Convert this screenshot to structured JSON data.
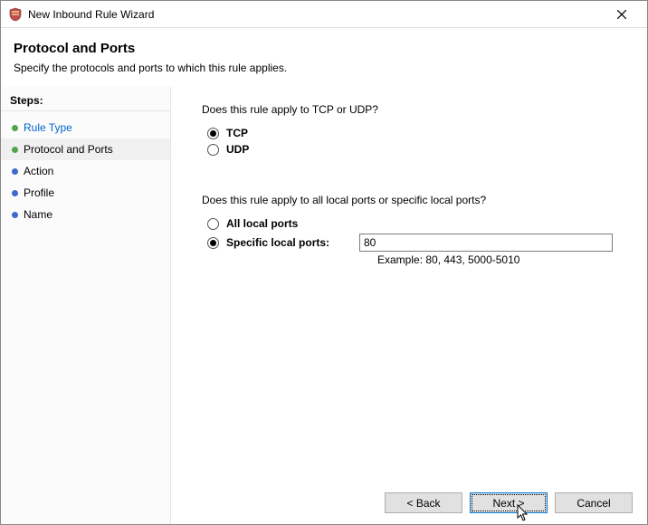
{
  "window": {
    "title": "New Inbound Rule Wizard"
  },
  "header": {
    "title": "Protocol and Ports",
    "subtitle": "Specify the protocols and ports to which this rule applies."
  },
  "sidebar": {
    "header": "Steps:",
    "items": [
      {
        "label": "Rule Type",
        "state": "done",
        "link": true
      },
      {
        "label": "Protocol and Ports",
        "state": "current",
        "link": false
      },
      {
        "label": "Action",
        "state": "pending",
        "link": false
      },
      {
        "label": "Profile",
        "state": "pending",
        "link": false
      },
      {
        "label": "Name",
        "state": "pending",
        "link": false
      }
    ]
  },
  "content": {
    "protocol_question": "Does this rule apply to TCP or UDP?",
    "tcp_label": "TCP",
    "udp_label": "UDP",
    "ports_question": "Does this rule apply to all local ports or specific local ports?",
    "all_ports_label": "All local ports",
    "specific_ports_label": "Specific local ports:",
    "ports_value": "80",
    "example_text": "Example: 80, 443, 5000-5010"
  },
  "buttons": {
    "back": "< Back",
    "next": "Next >",
    "cancel": "Cancel"
  }
}
